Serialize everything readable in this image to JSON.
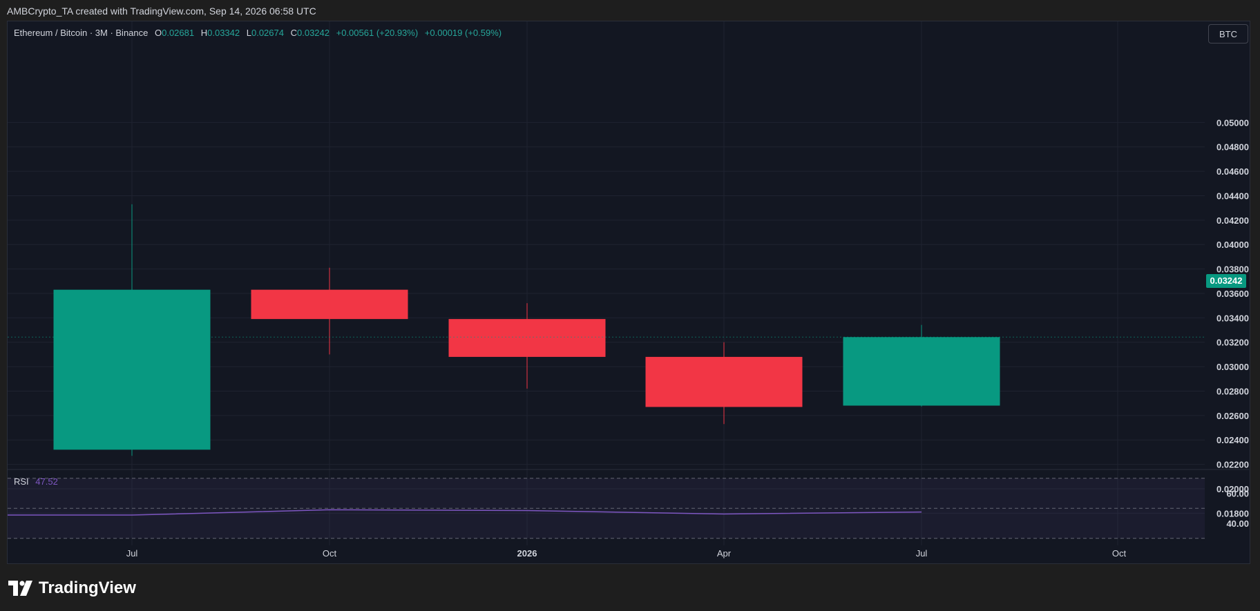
{
  "credit": "AMBCrypto_TA created with TradingView.com, Sep 14, 2026 06:58 UTC",
  "legend": {
    "symbol": "Ethereum / Bitcoin · 3M · Binance",
    "o_label": "O",
    "o_value": "0.02681",
    "h_label": "H",
    "h_value": "0.03342",
    "l_label": "L",
    "l_value": "0.02674",
    "c_label": "C",
    "c_value": "0.03242",
    "change": "+0.00561 (+20.93%)",
    "change2": "+0.00019 (+0.59%)"
  },
  "currency_button": "BTC",
  "last_price": "0.03242",
  "rsi": {
    "name": "RSI",
    "value": "47.52"
  },
  "brand": "TradingView",
  "colors": {
    "up": "#089981",
    "down": "#f23645",
    "rsi_line": "#7e57c2",
    "background": "#131722"
  },
  "chart_data": {
    "type": "candlestick",
    "interval": "3M",
    "x_labels": [
      "Jul",
      "Oct",
      "2026",
      "Apr",
      "Jul",
      "Oct"
    ],
    "y_ticks": [
      "0.05000",
      "0.04800",
      "0.04600",
      "0.04400",
      "0.04200",
      "0.04000",
      "0.03800",
      "0.03600",
      "0.03400",
      "0.03200",
      "0.03000",
      "0.02800",
      "0.02600",
      "0.02400",
      "0.02200",
      "0.02000",
      "0.01800"
    ],
    "ylim": [
      0.0175,
      0.0515
    ],
    "candles": [
      {
        "period": "Jul",
        "open": 0.0232,
        "high": 0.0433,
        "low": 0.0227,
        "close": 0.0363
      },
      {
        "period": "Oct",
        "open": 0.0363,
        "high": 0.0381,
        "low": 0.031,
        "close": 0.0339
      },
      {
        "period": "2026",
        "open": 0.0339,
        "high": 0.0352,
        "low": 0.0282,
        "close": 0.0308
      },
      {
        "period": "Apr",
        "open": 0.0308,
        "high": 0.032,
        "low": 0.0253,
        "close": 0.0267
      },
      {
        "period": "Jul",
        "open": 0.02681,
        "high": 0.03342,
        "low": 0.02674,
        "close": 0.03242
      }
    ],
    "rsi": {
      "label": "RSI",
      "current": 47.52,
      "levels": [
        70,
        50,
        30
      ],
      "y_ticks": [
        "60.00",
        "40.00"
      ],
      "values": [
        45.5,
        49.0,
        48.5,
        46.2,
        47.52
      ]
    }
  }
}
